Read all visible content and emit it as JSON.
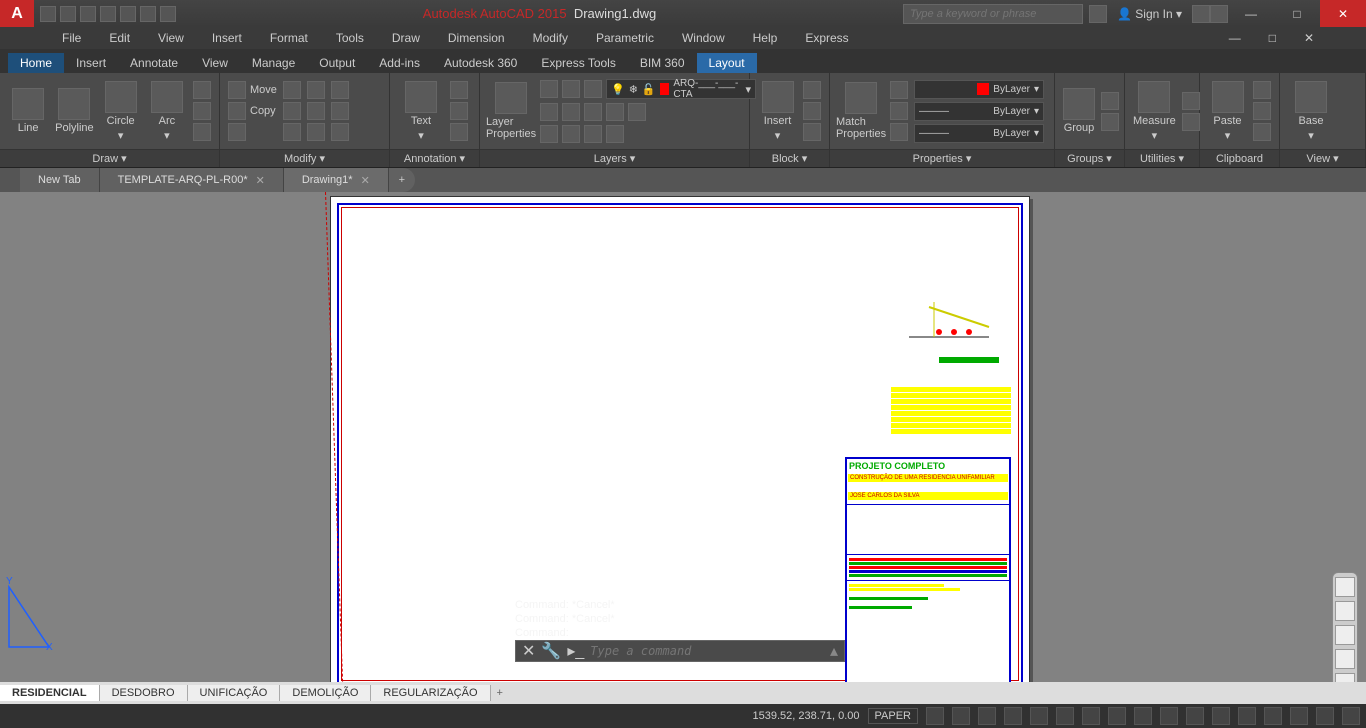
{
  "title": {
    "app": "Autodesk AutoCAD 2015",
    "doc": "Drawing1.dwg"
  },
  "search_placeholder": "Type a keyword or phrase",
  "signin": "Sign In",
  "menubar": [
    "File",
    "Edit",
    "View",
    "Insert",
    "Format",
    "Tools",
    "Draw",
    "Dimension",
    "Modify",
    "Parametric",
    "Window",
    "Help",
    "Express"
  ],
  "ribbon_tabs": [
    "Home",
    "Insert",
    "Annotate",
    "View",
    "Manage",
    "Output",
    "Add-ins",
    "Autodesk 360",
    "Express Tools",
    "BIM 360",
    "Layout"
  ],
  "ribbon_active": "Home",
  "ribbon_hl": "Layout",
  "panels": {
    "draw": {
      "title": "Draw ▾",
      "items": [
        "Line",
        "Polyline",
        "Circle",
        "Arc"
      ]
    },
    "modify": {
      "title": "Modify ▾",
      "move": "Move",
      "copy": "Copy"
    },
    "annotation": {
      "title": "Annotation ▾",
      "text": "Text"
    },
    "layers": {
      "title": "Layers ▾",
      "btn": "Layer Properties",
      "current": "ARQ-___-___-CTA"
    },
    "block": {
      "title": "Block ▾",
      "btn": "Insert"
    },
    "properties": {
      "title": "Properties ▾",
      "btn": "Match Properties",
      "color": "ByLayer",
      "ltype": "ByLayer",
      "lweight": "ByLayer"
    },
    "groups": {
      "title": "Groups ▾",
      "btn": "Group"
    },
    "utilities": {
      "title": "Utilities ▾",
      "btn": "Measure"
    },
    "clipboard": {
      "title": "Clipboard",
      "btn": "Paste"
    },
    "view": {
      "title": "View ▾",
      "btn": "Base"
    }
  },
  "doc_tabs": [
    "New Tab",
    "TEMPLATE-ARQ-PL-R00*",
    "Drawing1*"
  ],
  "doc_active": 2,
  "layout_tabs": [
    "RESIDENCIAL",
    "DESDOBRO",
    "UNIFICAÇÃO",
    "DEMOLIÇÃO",
    "REGULARIZAÇÃO"
  ],
  "layout_active": 0,
  "cmd_history": [
    "Command: *Cancel*",
    "Command: *Cancel*",
    "Command:"
  ],
  "cmd_placeholder": "Type a command",
  "status": {
    "coords": "1539.52, 238.71, 0.00",
    "space": "PAPER"
  },
  "titleblock": {
    "title": "PROJETO COMPLETO",
    "line1": "CONSTRUÇÃO DE UMA RESIDENCIA UNIFAMILIAR",
    "owner": "JOSE CARLOS DA SILVA"
  }
}
